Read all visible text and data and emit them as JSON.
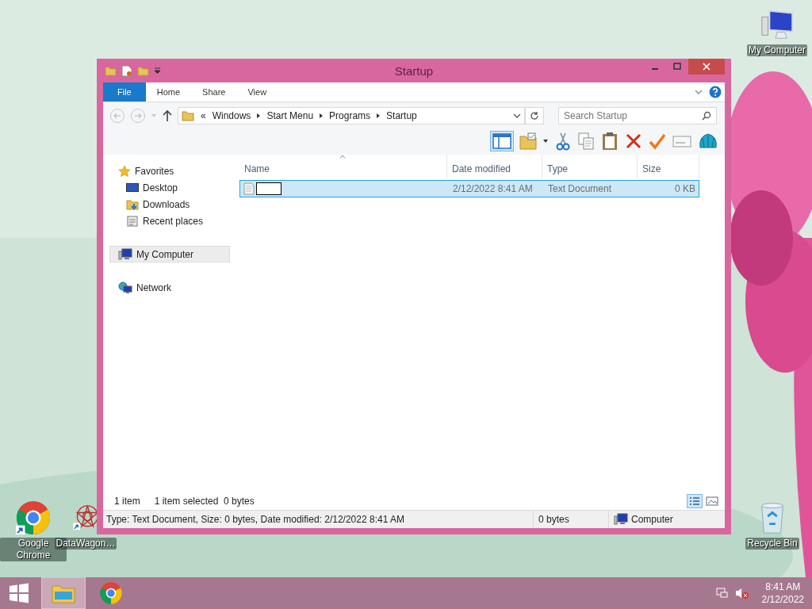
{
  "desktop_icons": [
    {
      "kind": "computer",
      "label": "My Computer"
    },
    {
      "kind": "chrome",
      "label": "Google Chrome"
    },
    {
      "kind": "datawagon",
      "label": "DataWagon…"
    },
    {
      "kind": "recycle",
      "label": "Recycle Bin"
    }
  ],
  "window": {
    "title": "Startup",
    "ribbon_tabs": [
      {
        "label": "File",
        "kind": "file"
      },
      {
        "label": "Home",
        "kind": "tab"
      },
      {
        "label": "Share",
        "kind": "tab"
      },
      {
        "label": "View",
        "kind": "tab"
      }
    ],
    "address": {
      "prefix": "«",
      "path": [
        "Windows",
        "Start Menu",
        "Programs",
        "Startup"
      ]
    },
    "search": {
      "placeholder": "Search Startup"
    },
    "navigation": [
      {
        "kind": "star",
        "label": "Favorites",
        "selected": false,
        "children": [
          {
            "kind": "desktop",
            "label": "Desktop",
            "selected": false
          },
          {
            "kind": "downloads",
            "label": "Downloads",
            "selected": false
          },
          {
            "kind": "recent",
            "label": "Recent places",
            "selected": false
          }
        ]
      },
      {
        "kind": "computer",
        "label": "My Computer",
        "selected": true
      },
      {
        "kind": "network",
        "label": "Network",
        "selected": false
      }
    ],
    "columns": [
      "Name",
      "Date modified",
      "Type",
      "Size"
    ],
    "rows": [
      {
        "renaming": true,
        "date_modified": "2/12/2022 8:41 AM",
        "type": "Text Document",
        "size": "0 KB",
        "selected": true
      }
    ],
    "item_bar": {
      "count": "1 item",
      "selection": "1 item selected",
      "size": "0 bytes"
    },
    "view_buttons": [
      {
        "kind": "details",
        "selected": true
      },
      {
        "kind": "large-icons",
        "selected": false
      }
    ],
    "status_bar": {
      "details": "Type: Text Document, Size: 0 bytes, Date modified: 2/12/2022 8:41 AM",
      "size": "0 bytes",
      "location": "Computer"
    }
  },
  "taskbar": {
    "apps": [
      {
        "kind": "explorer",
        "selected": true
      },
      {
        "kind": "chrome",
        "selected": false
      }
    ],
    "time": "8:41 AM",
    "date": "2/12/2022",
    "volume_muted": true
  }
}
